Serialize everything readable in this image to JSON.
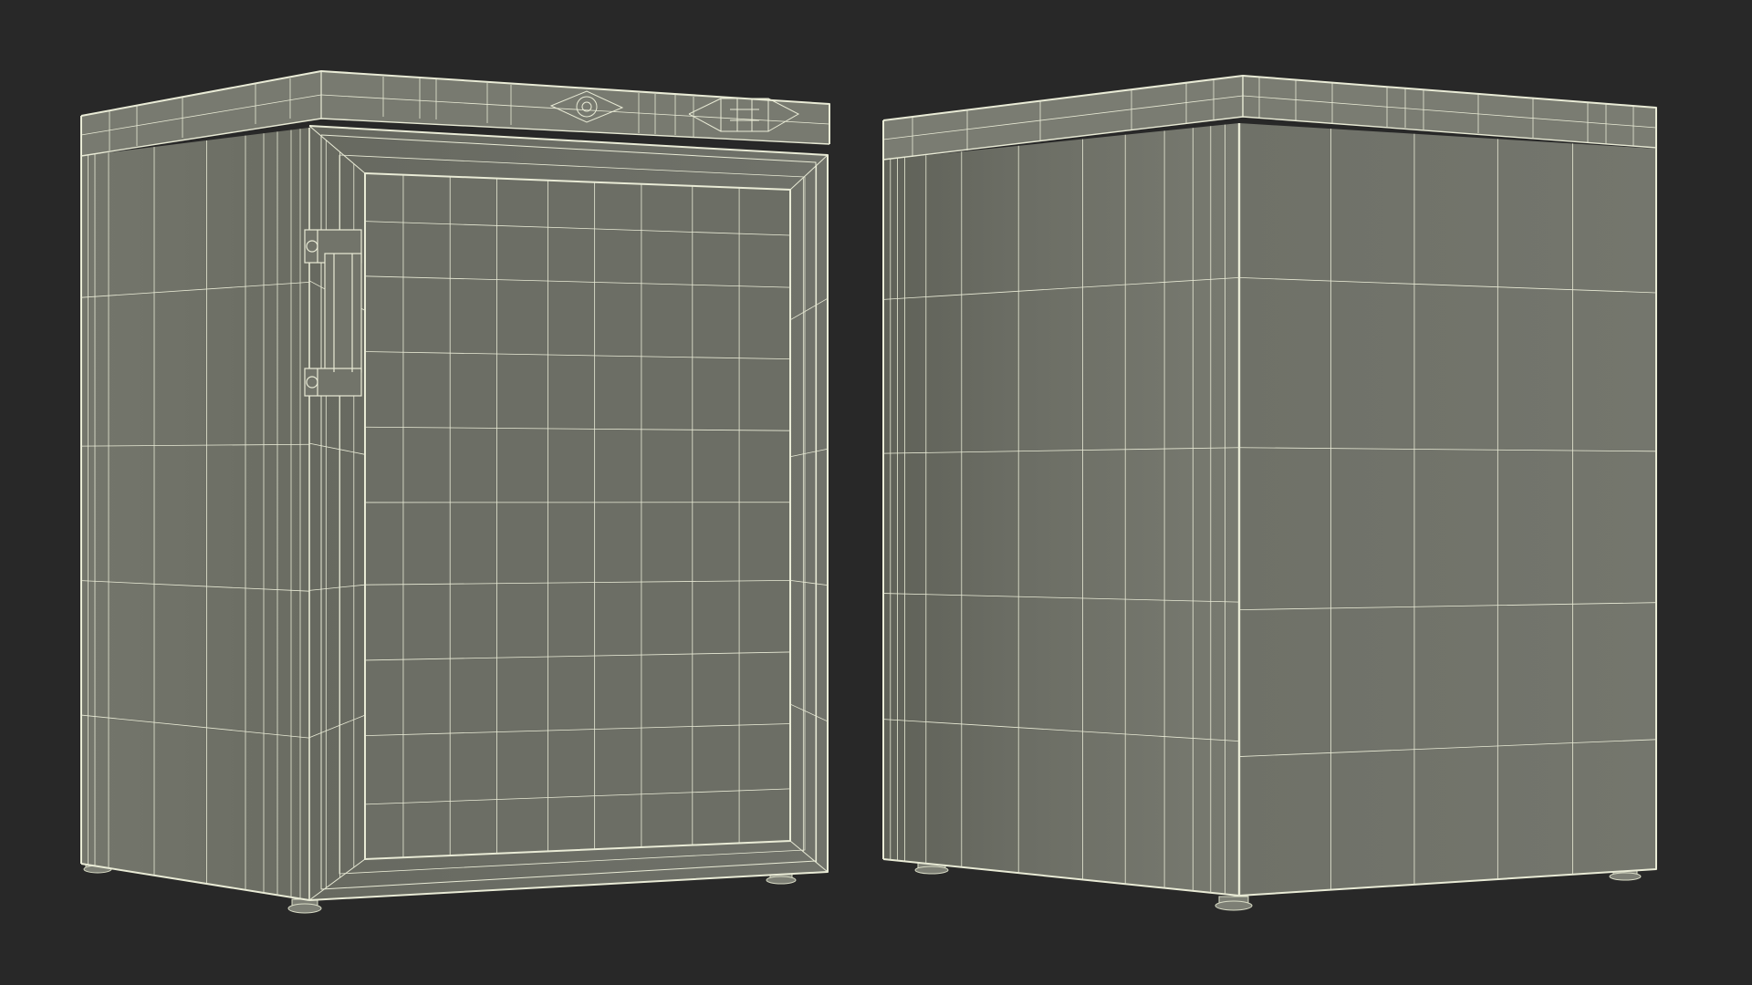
{
  "scene": {
    "background_color": "#282828",
    "surface_color": "#6b6d63",
    "wire_color": "#e9ebd6",
    "objects": [
      {
        "name": "refrigerator-front-view",
        "features": [
          "door",
          "handle",
          "hinge",
          "control-panel",
          "feet"
        ]
      },
      {
        "name": "refrigerator-back-view",
        "features": [
          "side-panel",
          "back-panel",
          "feet"
        ]
      }
    ]
  }
}
